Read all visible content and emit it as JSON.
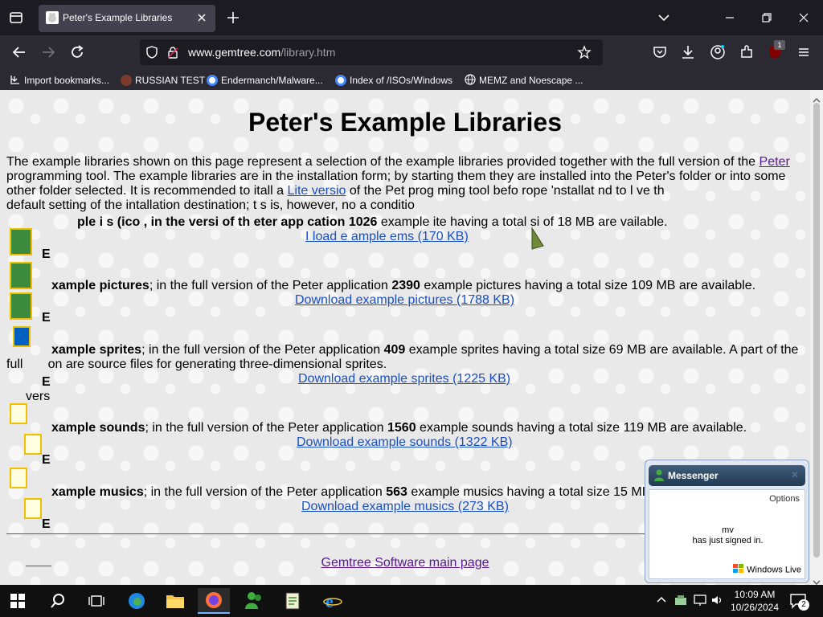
{
  "browser": {
    "tab_title": "Peter's Example Libraries",
    "url_domain": "www.gemtree.com",
    "url_path": "/library.htm",
    "extension_badge": "1",
    "bookmarks": [
      "Import bookmarks...",
      "RUSSIAN TEST",
      "Endermanch/Malware...",
      "Index of /ISOs/Windows",
      "MEMZ and Noescape ..."
    ]
  },
  "page": {
    "title": "Peter's Example Libraries",
    "intro_1": "The example libraries shown on this page represent a selection of the example libraries provided together with the full version of the",
    "intro_link_peter": "Peter",
    "intro_2": "programming tool. The example libraries are in the installation form; by starting them they are installed into the Peter's folder or into some other folder selected. It is recommended to i",
    "intro_3": "tall a",
    "intro_link_lite": "Lite versio",
    "intro_4": "of the Pet   prog        ming tool befo        rope  'nstallat       nd to l   ve th",
    "intro_5": "default setting of the intallation destination; t  s is, however, no  a conditio",
    "sections": [
      {
        "text_a": "ple i   s (ico      , in the          versi      of th       eter app  cation ",
        "count": "1026",
        "text_b": " example ite         having a total si     of 18 MB are    vailable.",
        "link": "I        load e   ample  ems (170 KB)"
      },
      {
        "label": "xample pictures",
        "text_a": "; in the full version of the Peter application ",
        "count": "2390",
        "text_b": " example pictures having a total size 109 MB are available.",
        "link": "Download example pictures (1788 KB)"
      },
      {
        "label": "xample sprites",
        "text_a": "; in the full version of the Peter application ",
        "count": "409",
        "text_b": " example sprites having a total size 69 MB are available. A part of the",
        "text_c": "on are source files for generating three-dimensional sprites.",
        "prefix_full": "full",
        "prefix_vers": "vers",
        "link": "Download example sprites (1225 KB)"
      },
      {
        "label": "xample sounds",
        "text_a": "; in the full version of the Peter application ",
        "count": "1560",
        "text_b": " example sounds having a total size 119 MB are available.",
        "link": "Download example sounds (1322 KB)"
      },
      {
        "label": "xample musics",
        "text_a": "; in the full version of the Peter application ",
        "count": "563",
        "text_b": " example musics having a total size 15 MI",
        "link": "Download example musics (273 KB)"
      }
    ],
    "letter": "E",
    "main_link": "Gemtree Software main page"
  },
  "messenger": {
    "title": "Messenger",
    "options": "Options",
    "user": "mv",
    "status": "has just signed in.",
    "logo": "Windows Live"
  },
  "taskbar": {
    "time": "10:09 AM",
    "date": "10/26/2024",
    "notification_count": "2"
  }
}
